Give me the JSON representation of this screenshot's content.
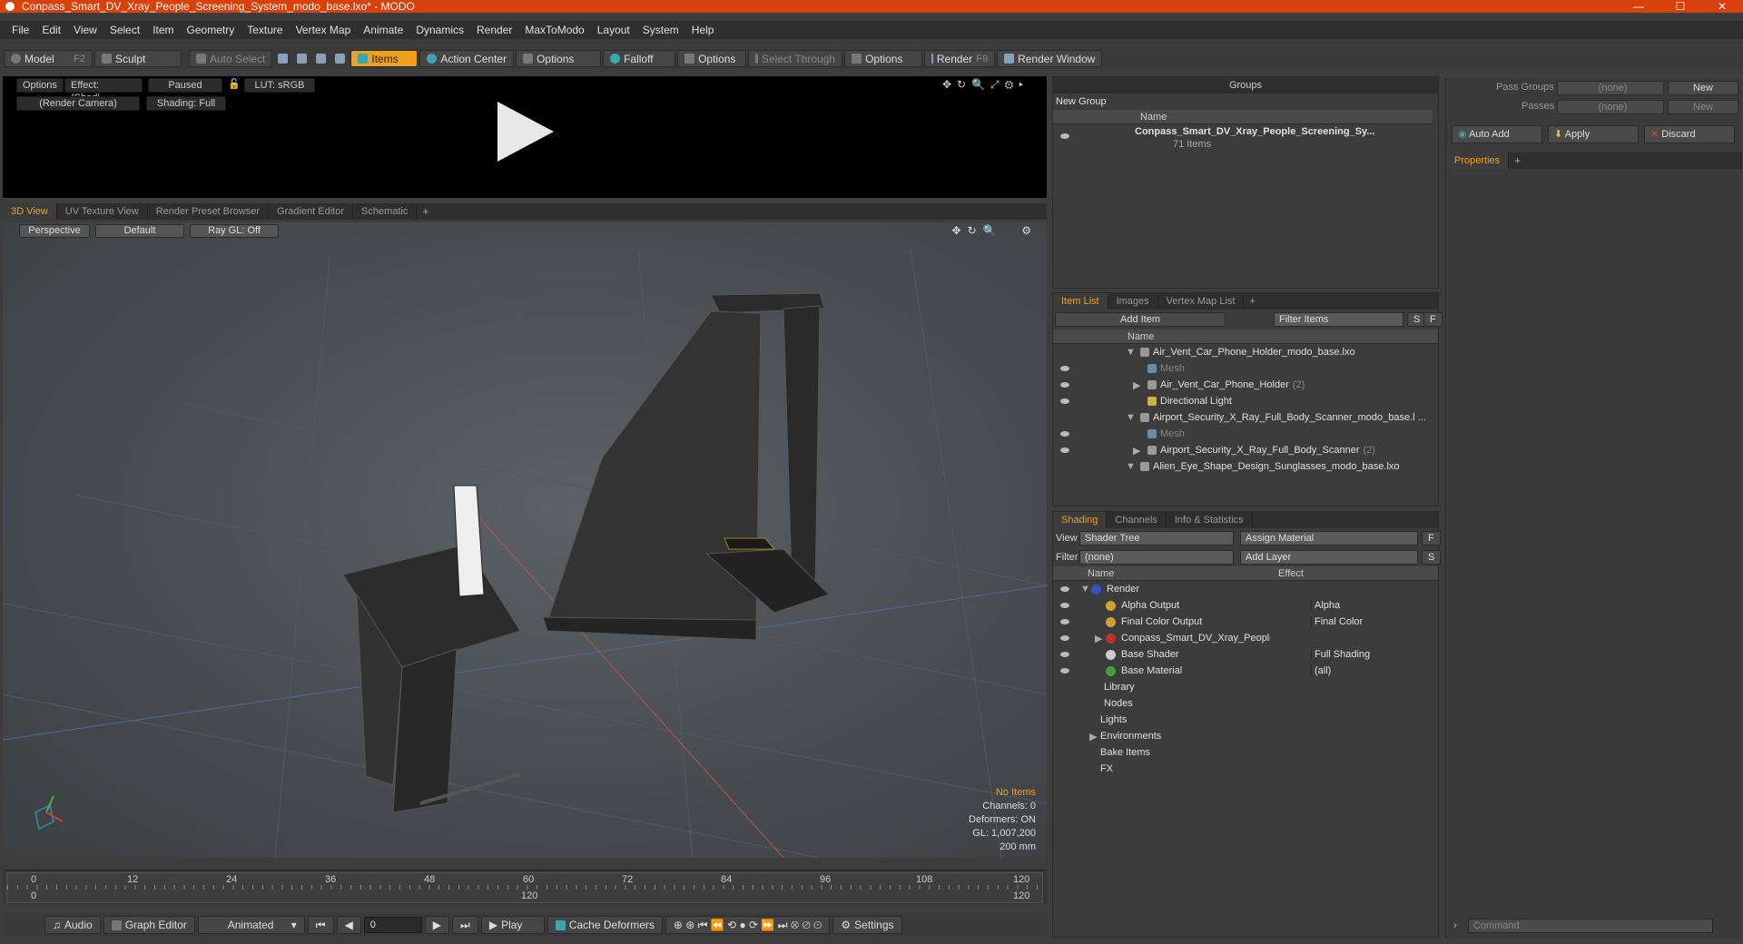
{
  "window": {
    "title": "Conpass_Smart_DV_Xray_People_Screening_System_modo_base.lxo* - MODO",
    "minimize": "—",
    "maximize": "☐",
    "close": "✕"
  },
  "menu": [
    "File",
    "Edit",
    "View",
    "Select",
    "Item",
    "Geometry",
    "Texture",
    "Vertex Map",
    "Animate",
    "Dynamics",
    "Render",
    "MaxToModo",
    "Layout",
    "System",
    "Help"
  ],
  "toolbar": {
    "model": "Model",
    "model_key": "F2",
    "sculpt": "Sculpt",
    "auto_select": "Auto Select",
    "items": "Items",
    "action_center": "Action Center",
    "options1": "Options",
    "falloff": "Falloff",
    "options2": "Options",
    "select_through": "Select Through",
    "options3": "Options",
    "render": "Render",
    "render_key": "F9",
    "render_window": "Render Window"
  },
  "render_view": {
    "options": "Options",
    "effect": "Effect: (Shadi...",
    "paused": "Paused",
    "lut": "LUT: sRGB",
    "camera": "(Render Camera)",
    "shading": "Shading: Full"
  },
  "view_tabs": [
    "3D View",
    "UV Texture View",
    "Render Preset Browser",
    "Gradient Editor",
    "Schematic"
  ],
  "view3d": {
    "perspective": "Perspective",
    "default": "Default",
    "raygl": "Ray GL: Off",
    "info": {
      "no_items": "No Items",
      "channels": "Channels: 0",
      "deformers": "Deformers: ON",
      "gl": "GL: 1,007,200",
      "scale": "200 mm"
    }
  },
  "timeline": {
    "ticks": [
      "0",
      "12",
      "24",
      "36",
      "48",
      "60",
      "72",
      "84",
      "96",
      "108",
      "120"
    ],
    "bottom_ticks": [
      "0",
      "120",
      "120"
    ]
  },
  "transport": {
    "audio": "Audio",
    "graph_editor": "Graph Editor",
    "animated": "Animated",
    "frame": "0",
    "play": "Play",
    "cache": "Cache Deformers",
    "settings": "Settings"
  },
  "groups": {
    "title": "Groups",
    "new_group": "New Group",
    "col_name": "Name",
    "item_name": "Conpass_Smart_DV_Xray_People_Screening_Sy...",
    "item_count": "71 Items"
  },
  "item_list": {
    "tabs": [
      "Item List",
      "Images",
      "Vertex Map List"
    ],
    "add_item": "Add Item",
    "filter": "Filter Items",
    "s": "S",
    "f": "F",
    "col_name": "Name",
    "rows": [
      {
        "label": "Air_Vent_Car_Phone_Holder_modo_base.lxo",
        "count": "",
        "indent": 0,
        "type": "scene"
      },
      {
        "label": "Mesh",
        "count": "",
        "indent": 1,
        "type": "mesh"
      },
      {
        "label": "Air_Vent_Car_Phone_Holder",
        "count": "(2)",
        "indent": 1,
        "type": "group"
      },
      {
        "label": "Directional Light",
        "count": "",
        "indent": 1,
        "type": "light"
      },
      {
        "label": "Airport_Security_X_Ray_Full_Body_Scanner_modo_base.l ...",
        "count": "",
        "indent": 0,
        "type": "scene"
      },
      {
        "label": "Mesh",
        "count": "",
        "indent": 1,
        "type": "mesh"
      },
      {
        "label": "Airport_Security_X_Ray_Full_Body_Scanner",
        "count": "(2)",
        "indent": 1,
        "type": "group"
      },
      {
        "label": "Alien_Eye_Shape_Design_Sunglasses_modo_base.lxo",
        "count": "",
        "indent": 0,
        "type": "scene"
      }
    ]
  },
  "shading": {
    "tabs": [
      "Shading",
      "Channels",
      "Info & Statistics"
    ],
    "view_label": "View",
    "view_value": "Shader Tree",
    "assign": "Assign Material",
    "f": "F",
    "filter_label": "Filter",
    "filter_value": "(none)",
    "add_layer": "Add Layer",
    "s": "S",
    "col_name": "Name",
    "col_effect": "Effect",
    "rows": [
      {
        "label": "Render",
        "effect": "",
        "color": "#3a4cc8"
      },
      {
        "label": "Alpha Output",
        "effect": "Alpha",
        "color": "#d0a030"
      },
      {
        "label": "Final Color Output",
        "effect": "Final Color",
        "color": "#d0a030"
      },
      {
        "label": "Conpass_Smart_DV_Xray_People_Scre...",
        "effect": "",
        "color": "#c03030"
      },
      {
        "label": "Base Shader",
        "effect": "Full Shading",
        "color": "#cccccc"
      },
      {
        "label": "Base Material",
        "effect": "(all)",
        "color": "#40a040"
      },
      {
        "label": "Library",
        "effect": "",
        "color": ""
      },
      {
        "label": "Nodes",
        "effect": "",
        "color": ""
      },
      {
        "label": "Lights",
        "effect": "",
        "color": ""
      },
      {
        "label": "Environments",
        "effect": "",
        "color": ""
      },
      {
        "label": "Bake Items",
        "effect": "",
        "color": ""
      },
      {
        "label": "FX",
        "effect": "",
        "color": ""
      }
    ]
  },
  "properties": {
    "pass_groups_label": "Pass Groups",
    "pass_groups_value": "(none)",
    "new1": "New",
    "passes_label": "Passes",
    "passes_value": "(none)",
    "new2": "New",
    "auto_add": "Auto Add",
    "apply": "Apply",
    "discard": "Discard",
    "tab": "Properties",
    "command_placeholder": "Command"
  },
  "colors": {
    "accent": "#f0a020",
    "title_bar": "#d8410a"
  }
}
